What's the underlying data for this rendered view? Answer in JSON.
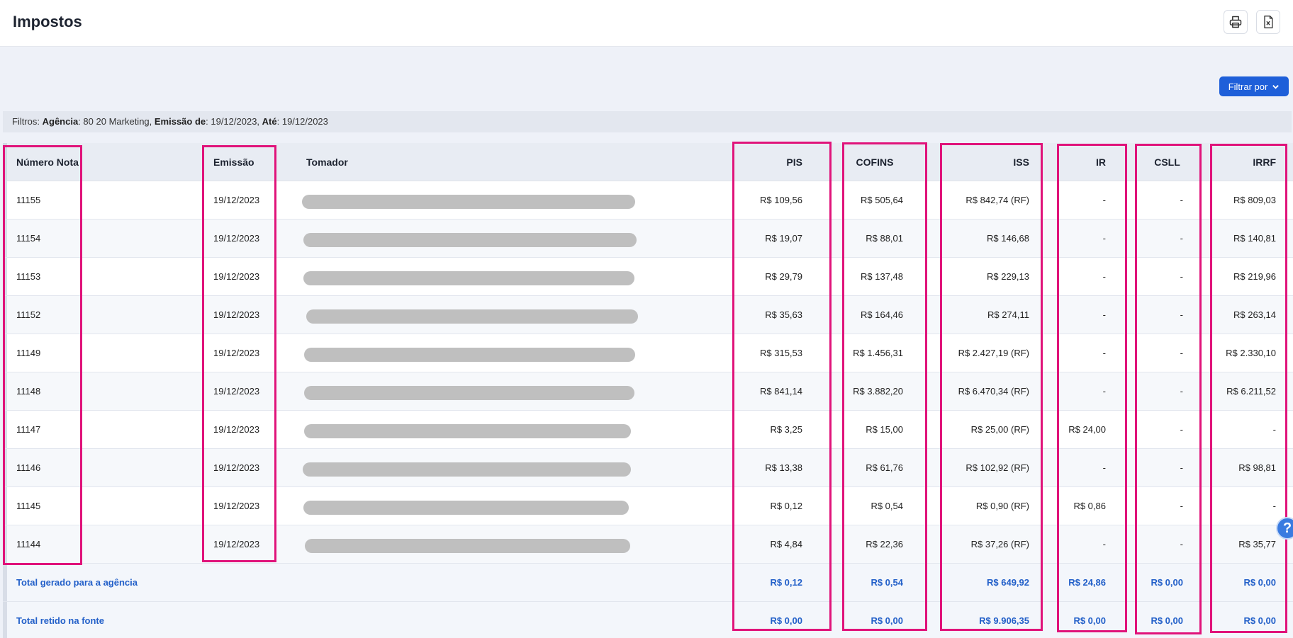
{
  "page": {
    "title": "Impostos"
  },
  "toolbar": {
    "print_icon": "printer-icon",
    "excel_icon": "excel-export-icon"
  },
  "filter_button": {
    "label": "Filtrar por",
    "icon": "chevron-down-icon"
  },
  "filters": {
    "prefix": "Filtros: ",
    "agencia_label": "Agência",
    "agencia_value": ": 80 20 Marketing, ",
    "emissao_label": "Emissão de",
    "emissao_value": ": 19/12/2023, ",
    "ate_label": "Até",
    "ate_value": ": 19/12/2023"
  },
  "columns": {
    "nota": "Número Nota",
    "emissao": "Emissão",
    "tomador": "Tomador",
    "pis": "PIS",
    "cofins": "COFINS",
    "iss": "ISS",
    "ir": "IR",
    "csll": "CSLL",
    "irrf": "IRRF"
  },
  "rows": [
    {
      "nota": "11155",
      "emissao": "19/12/2023",
      "pis": "R$ 109,56",
      "cofins": "R$ 505,64",
      "iss": "R$ 842,74 (RF)",
      "ir": "-",
      "csll": "-",
      "irrf": "R$ 809,03"
    },
    {
      "nota": "11154",
      "emissao": "19/12/2023",
      "pis": "R$ 19,07",
      "cofins": "R$ 88,01",
      "iss": "R$ 146,68",
      "ir": "-",
      "csll": "-",
      "irrf": "R$ 140,81"
    },
    {
      "nota": "11153",
      "emissao": "19/12/2023",
      "pis": "R$ 29,79",
      "cofins": "R$ 137,48",
      "iss": "R$ 229,13",
      "ir": "-",
      "csll": "-",
      "irrf": "R$ 219,96"
    },
    {
      "nota": "11152",
      "emissao": "19/12/2023",
      "pis": "R$ 35,63",
      "cofins": "R$ 164,46",
      "iss": "R$ 274,11",
      "ir": "-",
      "csll": "-",
      "irrf": "R$ 263,14"
    },
    {
      "nota": "11149",
      "emissao": "19/12/2023",
      "pis": "R$ 315,53",
      "cofins": "R$ 1.456,31",
      "iss": "R$ 2.427,19 (RF)",
      "ir": "-",
      "csll": "-",
      "irrf": "R$ 2.330,10"
    },
    {
      "nota": "11148",
      "emissao": "19/12/2023",
      "pis": "R$ 841,14",
      "cofins": "R$ 3.882,20",
      "iss": "R$ 6.470,34 (RF)",
      "ir": "-",
      "csll": "-",
      "irrf": "R$ 6.211,52"
    },
    {
      "nota": "11147",
      "emissao": "19/12/2023",
      "pis": "R$ 3,25",
      "cofins": "R$ 15,00",
      "iss": "R$ 25,00 (RF)",
      "ir": "R$ 24,00",
      "csll": "-",
      "irrf": "-"
    },
    {
      "nota": "11146",
      "emissao": "19/12/2023",
      "pis": "R$ 13,38",
      "cofins": "R$ 61,76",
      "iss": "R$ 102,92 (RF)",
      "ir": "-",
      "csll": "-",
      "irrf": "R$ 98,81"
    },
    {
      "nota": "11145",
      "emissao": "19/12/2023",
      "pis": "R$ 0,12",
      "cofins": "R$ 0,54",
      "iss": "R$ 0,90 (RF)",
      "ir": "R$ 0,86",
      "csll": "-",
      "irrf": "-"
    },
    {
      "nota": "11144",
      "emissao": "19/12/2023",
      "pis": "R$ 4,84",
      "cofins": "R$ 22,36",
      "iss": "R$ 37,26 (RF)",
      "ir": "-",
      "csll": "-",
      "irrf": "R$ 35,77"
    }
  ],
  "totals": [
    {
      "label": "Total gerado para a agência",
      "pis": "R$ 0,12",
      "cofins": "R$ 0,54",
      "iss": "R$ 649,92",
      "ir": "R$ 24,86",
      "csll": "R$ 0,00",
      "irrf": "R$ 0,00"
    },
    {
      "label": "Total retido na fonte",
      "pis": "R$ 0,00",
      "cofins": "R$ 0,00",
      "iss": "R$ 9.906,35",
      "ir": "R$ 0,00",
      "csll": "R$ 0,00",
      "irrf": "R$ 0,00"
    }
  ],
  "help": {
    "label": "?"
  },
  "colors": {
    "accent": "#1e5fd9",
    "highlight": "#e0137a",
    "total_text": "#2360c9"
  }
}
